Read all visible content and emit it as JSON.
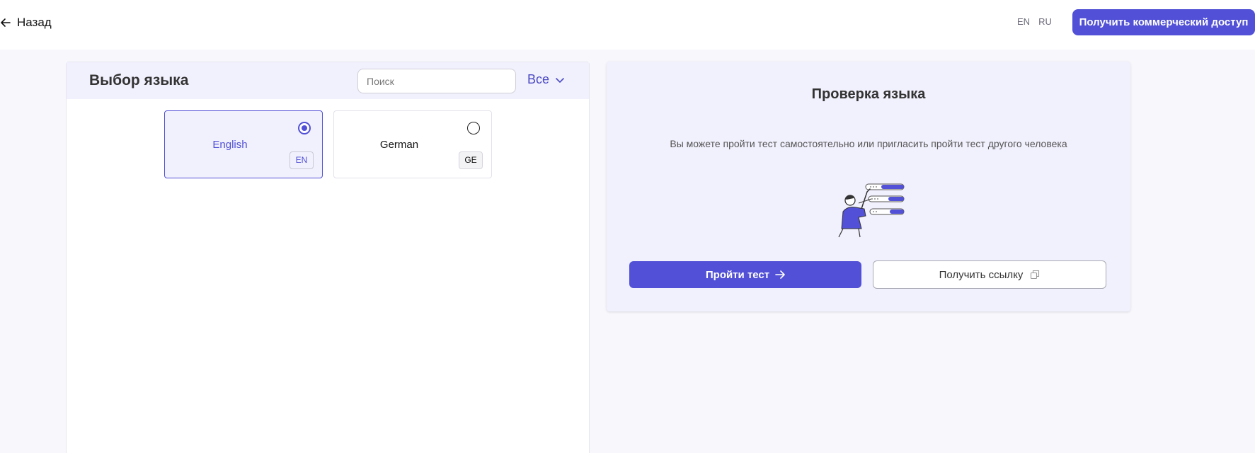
{
  "header": {
    "back_label": "Назад",
    "languages": [
      "EN",
      "RU"
    ],
    "cta_label": "Получить коммерческий доступ"
  },
  "language_panel": {
    "title": "Выбор языка",
    "search_placeholder": "Поиск",
    "filter_label": "Все",
    "cards": [
      {
        "label": "English",
        "code": "EN",
        "selected": true
      },
      {
        "label": "German",
        "code": "GE",
        "selected": false
      }
    ]
  },
  "check_panel": {
    "title": "Проверка языка",
    "description": "Вы можете пройти тест самостоятельно или пригласить пройти тест другого человека",
    "primary_label": "Пройти тест",
    "secondary_label": "Получить ссылку"
  },
  "icons": {
    "back": "arrow-left-icon",
    "filter": "chevron-down-icon",
    "primary": "arrow-right-icon",
    "secondary": "copy-icon"
  },
  "colors": {
    "accent": "#5150d6",
    "panel_tint": "#f1f0fd",
    "page_background": "#f7f7fc"
  }
}
